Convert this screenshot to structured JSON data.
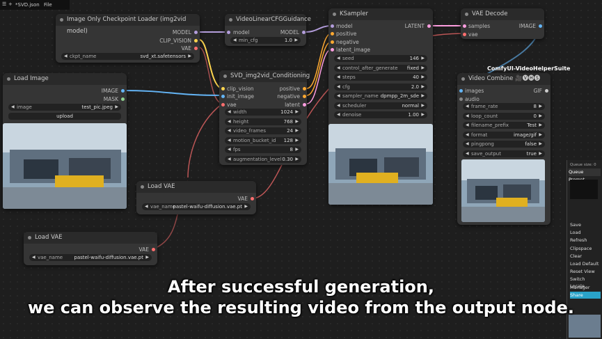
{
  "topbar": {
    "file": "*SVD.json",
    "menu": "File"
  },
  "nodes": {
    "checkpoint": {
      "title": "Image Only Checkpoint Loader (img2vid model)",
      "out": [
        "MODEL",
        "CLIP_VISION",
        "VAE"
      ],
      "ckpt_label": "ckpt_name",
      "ckpt_value": "svd_xt.safetensors"
    },
    "cfg": {
      "title": "VideoLinearCFGGuidance",
      "in": "model",
      "out": "MODEL",
      "min_cfg_label": "min_cfg",
      "min_cfg_value": "1.0"
    },
    "ksampler": {
      "title": "KSampler",
      "in": [
        "model",
        "positive",
        "negative",
        "latent_image"
      ],
      "out": "LATENT",
      "widgets": [
        {
          "label": "seed",
          "value": "146"
        },
        {
          "label": "control_after_generate",
          "value": "fixed"
        },
        {
          "label": "steps",
          "value": "40"
        },
        {
          "label": "cfg",
          "value": "2.0"
        },
        {
          "label": "sampler_name",
          "value": "dpmpp_2m_sde"
        },
        {
          "label": "scheduler",
          "value": "normal"
        },
        {
          "label": "denoise",
          "value": "1.00"
        }
      ]
    },
    "vaedecode": {
      "title": "VAE Decode",
      "in": [
        "samples",
        "vae"
      ],
      "out": "IMAGE"
    },
    "loadimage": {
      "title": "Load Image",
      "out": [
        "IMAGE",
        "MASK"
      ],
      "image_label": "image",
      "image_value": "test_pic.jpeg",
      "upload": "upload"
    },
    "conditioning": {
      "title": "SVD_img2vid_Conditioning",
      "in": [
        "clip_vision",
        "init_image",
        "vae"
      ],
      "out": [
        "positive",
        "negative",
        "latent"
      ],
      "widgets": [
        {
          "label": "width",
          "value": "1024"
        },
        {
          "label": "height",
          "value": "768"
        },
        {
          "label": "video_frames",
          "value": "24"
        },
        {
          "label": "motion_bucket_id",
          "value": "128"
        },
        {
          "label": "fps",
          "value": "8"
        },
        {
          "label": "augmentation_level",
          "value": "0.30"
        }
      ]
    },
    "loadvae1": {
      "title": "Load VAE",
      "out": "VAE",
      "vae_label": "vae_name",
      "vae_value": "pastel-waifu-diffusion.vae.pt"
    },
    "loadvae2": {
      "title": "Load VAE",
      "out": "VAE",
      "vae_label": "vae_name",
      "vae_value": "pastel-waifu-diffusion.vae.pt"
    },
    "videocombine": {
      "title": "Video Combine 🎥🅥🅗🅢",
      "group": "ComfyUI-VideoHelperSuite",
      "in": [
        "images",
        "audio"
      ],
      "out": "GIF",
      "widgets": [
        {
          "label": "frame_rate",
          "value": "8"
        },
        {
          "label": "loop_count",
          "value": "0"
        },
        {
          "label": "filename_prefix",
          "value": "Test"
        },
        {
          "label": "format",
          "value": "image/gif"
        },
        {
          "label": "pingpong",
          "value": "false"
        },
        {
          "label": "save_output",
          "value": "true"
        }
      ]
    }
  },
  "panel": {
    "queue_size": "Queue size: 0",
    "queue_prompt": "Queue Prompt",
    "buttons": [
      "Save",
      "Load",
      "Refresh",
      "Clipspace",
      "Clear",
      "Load Default",
      "Reset View",
      "Switch Locale",
      "Manager",
      "Share"
    ]
  },
  "caption": {
    "line1": "After successful generation,",
    "line2": "we can observe the resulting video from the output node."
  },
  "colors": {
    "model": "#b39ddb",
    "clip": "#ffd54f",
    "vae": "#ff6e6e",
    "image": "#64b5f6",
    "latent": "#ff9ee0",
    "cond": "#ffa931"
  }
}
